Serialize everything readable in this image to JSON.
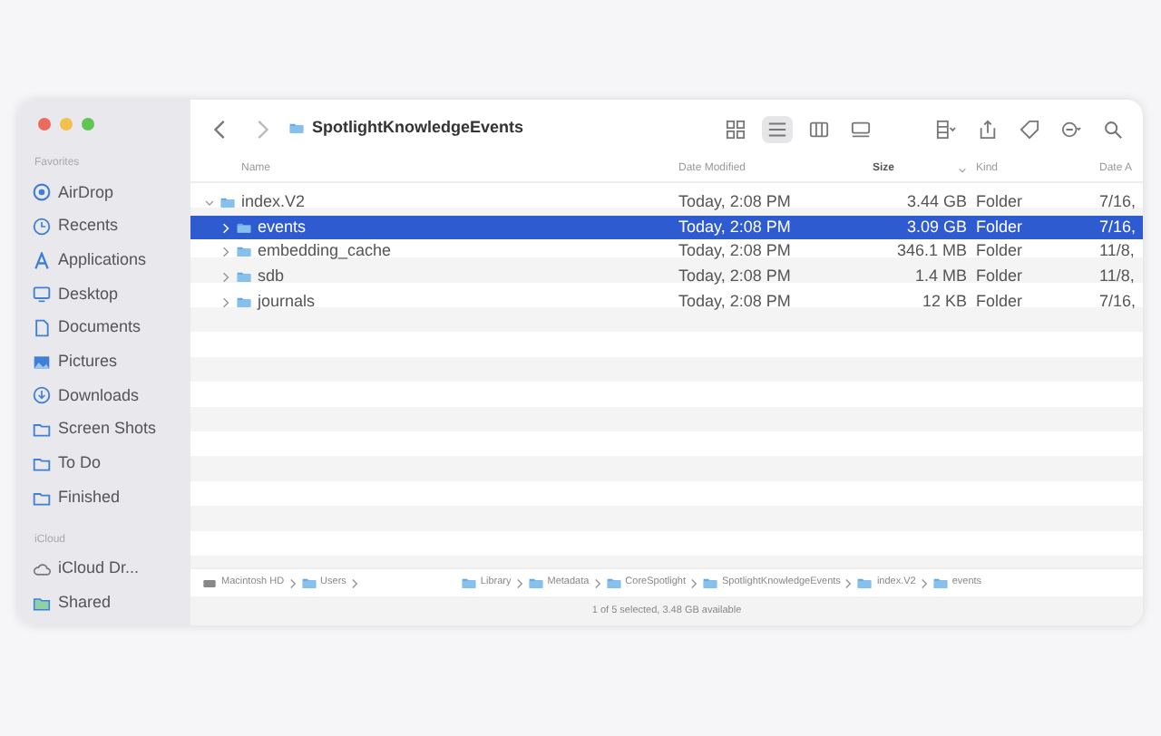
{
  "window": {
    "title": "SpotlightKnowledgeEvents"
  },
  "sidebar": {
    "sections": [
      {
        "heading": "Favorites",
        "items": [
          {
            "label": "AirDrop",
            "kind": "airdrop"
          },
          {
            "label": "Recents",
            "kind": "clock"
          },
          {
            "label": "Applications",
            "kind": "apps"
          },
          {
            "label": "Desktop",
            "kind": "desktop"
          },
          {
            "label": "Documents",
            "kind": "document"
          },
          {
            "label": "Pictures",
            "kind": "pictures"
          },
          {
            "label": "Downloads",
            "kind": "download"
          },
          {
            "label": "Screen Shots",
            "kind": "folder"
          },
          {
            "label": "To Do",
            "kind": "folder"
          },
          {
            "label": "Finished",
            "kind": "folder"
          }
        ]
      },
      {
        "heading": "iCloud",
        "items": [
          {
            "label": "iCloud Dr...",
            "kind": "cloud"
          },
          {
            "label": "Shared",
            "kind": "shared"
          }
        ]
      }
    ]
  },
  "toolbar": {
    "view_modes": [
      {
        "kind": "icons",
        "selected": false
      },
      {
        "kind": "list",
        "selected": true
      },
      {
        "kind": "columns",
        "selected": false
      },
      {
        "kind": "gallery",
        "selected": false
      }
    ]
  },
  "table": {
    "columns": [
      {
        "label": "Name",
        "sorted": false
      },
      {
        "label": "Date Modified",
        "sorted": false
      },
      {
        "label": "Size",
        "sorted": true
      },
      {
        "label": "Kind",
        "sorted": false
      },
      {
        "label": "Date A",
        "sorted": false
      }
    ],
    "rows": [
      {
        "name": "index.V2",
        "date_modified": "Today, 2:08 PM",
        "size": "3.44 GB",
        "kind": "Folder",
        "date_added": "7/16,",
        "expanded": true,
        "selected": false,
        "children": [
          {
            "name": "events",
            "date_modified": "Today, 2:08 PM",
            "size": "3.09 GB",
            "kind": "Folder",
            "date_added": "7/16,",
            "expanded": false,
            "selected": true
          },
          {
            "name": "embedding_cache",
            "date_modified": "Today, 2:08 PM",
            "size": "346.1 MB",
            "kind": "Folder",
            "date_added": "11/8,",
            "expanded": false,
            "selected": false
          },
          {
            "name": "sdb",
            "date_modified": "Today, 2:08 PM",
            "size": "1.4 MB",
            "kind": "Folder",
            "date_added": "11/8,",
            "expanded": false,
            "selected": false
          },
          {
            "name": "journals",
            "date_modified": "Today, 2:08 PM",
            "size": "12 KB",
            "kind": "Folder",
            "date_added": "7/16,",
            "expanded": false,
            "selected": false
          }
        ]
      }
    ]
  },
  "path_bar": [
    {
      "label": "Macintosh HD",
      "kind": "disk"
    },
    {
      "label": "Users",
      "kind": "folder"
    },
    {
      "label": "Library",
      "kind": "folder"
    },
    {
      "label": "Metadata",
      "kind": "folder"
    },
    {
      "label": "CoreSpotlight",
      "kind": "folder"
    },
    {
      "label": "SpotlightKnowledgeEvents",
      "kind": "folder"
    },
    {
      "label": "index.V2",
      "kind": "folder"
    },
    {
      "label": "events",
      "kind": "folder"
    }
  ],
  "status_bar": "1 of 5 selected, 3.48 GB available"
}
